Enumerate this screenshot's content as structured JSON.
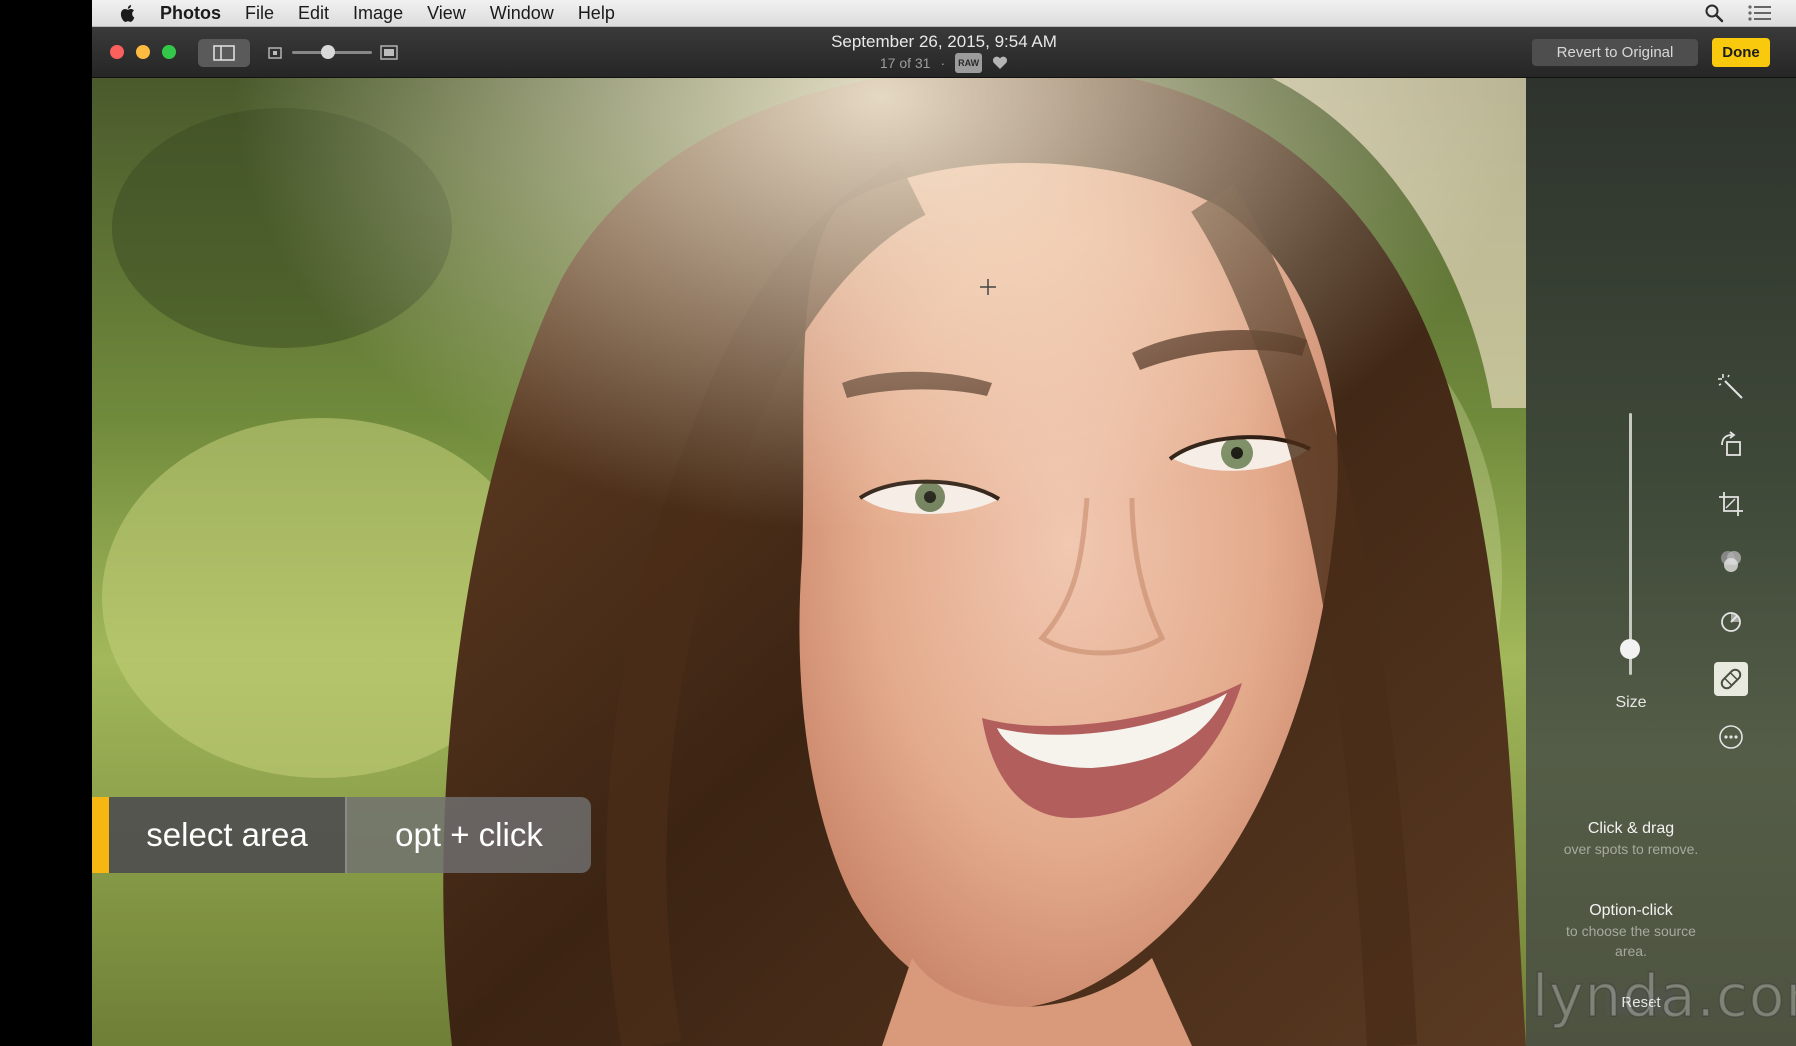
{
  "menubar": {
    "app_name": "Photos",
    "items": [
      "File",
      "Edit",
      "Image",
      "View",
      "Window",
      "Help"
    ]
  },
  "toolbar": {
    "title": "September 26, 2015, 9:54 AM",
    "position": "17 of 31",
    "raw_badge": "RAW",
    "revert_label": "Revert to Original",
    "done_label": "Done",
    "zoom_level": 0.45
  },
  "panel": {
    "size_label": "Size",
    "size_value": 0.1,
    "help": [
      {
        "title": "Click & drag",
        "text": "over spots to remove."
      },
      {
        "title": "Option-click",
        "text": "to choose the source area."
      }
    ],
    "reset_label": "Reset",
    "tools": [
      "enhance-icon",
      "rotate-icon",
      "crop-icon",
      "filters-icon",
      "adjust-icon",
      "retouch-icon",
      "extensions-icon"
    ]
  },
  "caption": {
    "select": "select area",
    "opt": "opt + click"
  },
  "watermark": "lynda.com",
  "colors": {
    "done": "#f9c90d",
    "accent": "#f6b713",
    "close": "#fc605c",
    "minimize": "#fdbc40",
    "maximize": "#34c84a"
  }
}
